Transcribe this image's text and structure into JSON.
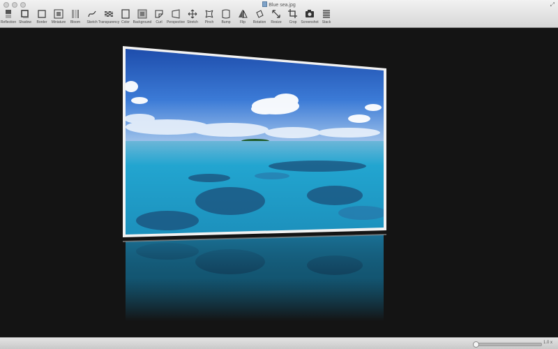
{
  "window": {
    "title": "Blue sea.jpg",
    "fullscreen_icon": "expand-arrows-icon"
  },
  "toolbar": {
    "items": [
      {
        "label": "Reflection",
        "icon": "reflection-icon"
      },
      {
        "label": "Shadow",
        "icon": "shadow-icon"
      },
      {
        "label": "Border",
        "icon": "border-icon"
      },
      {
        "label": "Miniature",
        "icon": "miniature-icon"
      },
      {
        "label": "Bloom",
        "icon": "bloom-icon"
      },
      {
        "label": "Sketch",
        "icon": "sketch-icon"
      },
      {
        "label": "Transparency",
        "icon": "transparency-icon"
      },
      {
        "label": "Color",
        "icon": "color-icon"
      },
      {
        "label": "Background",
        "icon": "background-icon"
      },
      {
        "label": "Curl",
        "icon": "curl-icon"
      },
      {
        "label": "Perspective",
        "icon": "perspective-icon"
      },
      {
        "label": "Stretch",
        "icon": "stretch-icon"
      },
      {
        "label": "Pinch",
        "icon": "pinch-icon"
      },
      {
        "label": "Bump",
        "icon": "bump-icon"
      },
      {
        "label": "Flip",
        "icon": "flip-icon"
      },
      {
        "label": "Rotation",
        "icon": "rotation-icon"
      },
      {
        "label": "Resize",
        "icon": "resize-icon"
      },
      {
        "label": "Crop",
        "icon": "crop-icon"
      },
      {
        "label": "Screenshot",
        "icon": "camera-icon"
      },
      {
        "label": "Stack",
        "icon": "stack-icon"
      }
    ]
  },
  "status": {
    "zoom": "1.0 x",
    "zoom_level": 0.0
  },
  "colors": {
    "canvas_bg": "#141414",
    "sky": "#1f56b8",
    "sea": "#1e9fc8"
  }
}
